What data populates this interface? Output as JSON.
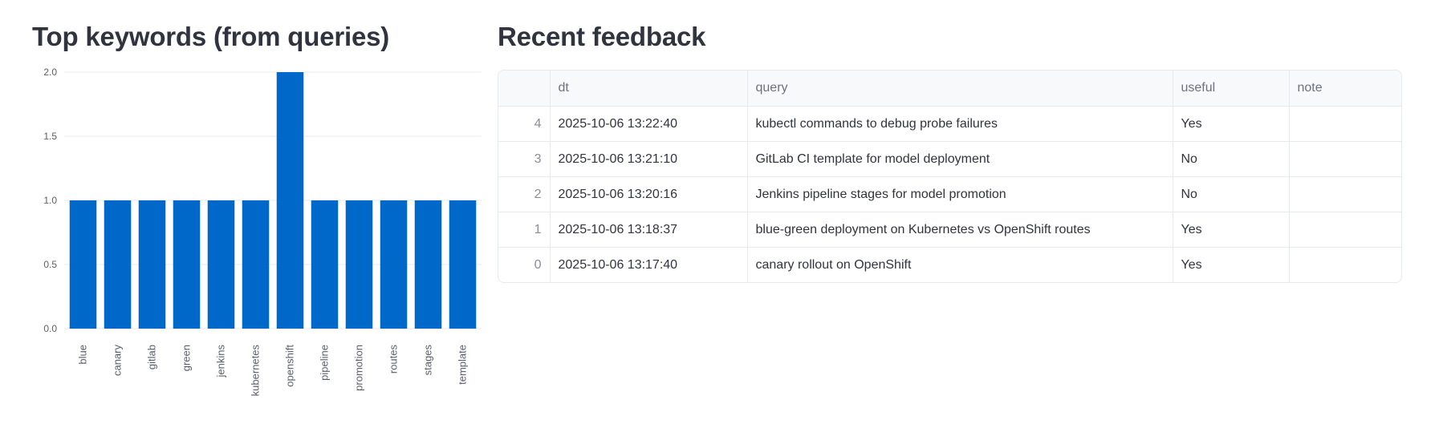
{
  "left_panel": {
    "title": "Top keywords (from queries)"
  },
  "right_panel": {
    "title": "Recent feedback"
  },
  "chart_data": {
    "type": "bar",
    "title": "",
    "xlabel": "",
    "ylabel": "",
    "categories": [
      "blue",
      "canary",
      "gitlab",
      "green",
      "jenkins",
      "kubernetes",
      "openshift",
      "pipeline",
      "promotion",
      "routes",
      "stages",
      "template"
    ],
    "values": [
      1,
      1,
      1,
      1,
      1,
      1,
      2,
      1,
      1,
      1,
      1,
      1
    ],
    "ylim": [
      0,
      2
    ],
    "yticks": [
      "0.0",
      "0.5",
      "1.0",
      "1.5",
      "2.0"
    ],
    "bar_color": "#0068c9",
    "grid": true
  },
  "table": {
    "columns": [
      "",
      "dt",
      "query",
      "useful",
      "note"
    ],
    "rows": [
      [
        "4",
        "2025-10-06 13:22:40",
        "kubectl commands to debug probe failures",
        "Yes",
        ""
      ],
      [
        "3",
        "2025-10-06 13:21:10",
        "GitLab CI template for model deployment",
        "No",
        ""
      ],
      [
        "2",
        "2025-10-06 13:20:16",
        "Jenkins pipeline stages for model promotion",
        "No",
        ""
      ],
      [
        "1",
        "2025-10-06 13:18:37",
        "blue-green deployment on Kubernetes vs OpenShift routes",
        "Yes",
        ""
      ],
      [
        "0",
        "2025-10-06 13:17:40",
        "canary rollout on OpenShift",
        "Yes",
        ""
      ]
    ]
  }
}
